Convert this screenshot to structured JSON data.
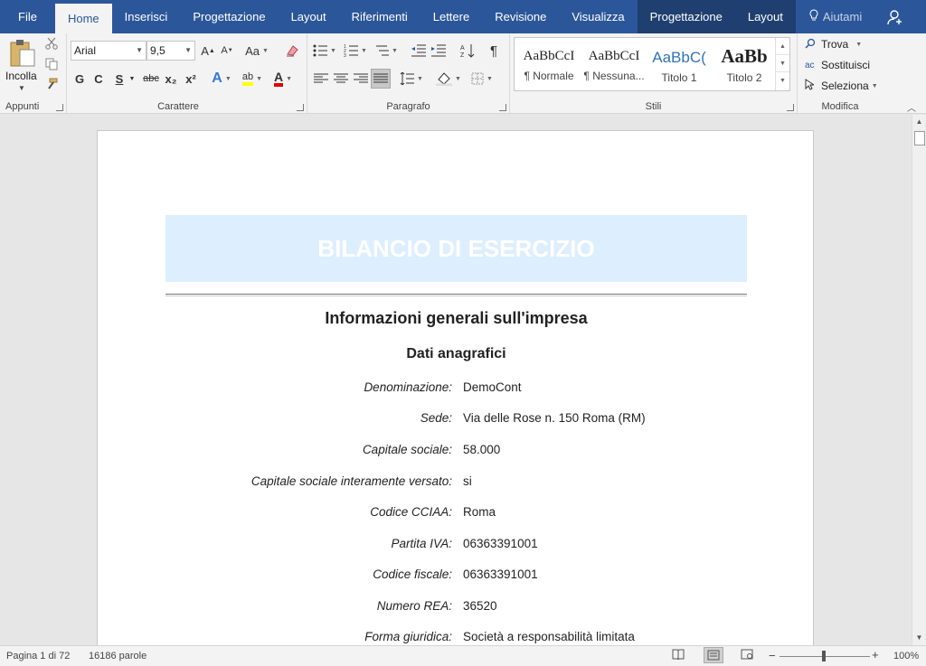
{
  "tabs": [
    {
      "label": "File"
    },
    {
      "label": "Home"
    },
    {
      "label": "Inserisci"
    },
    {
      "label": "Progettazione"
    },
    {
      "label": "Layout"
    },
    {
      "label": "Riferimenti"
    },
    {
      "label": "Lettere"
    },
    {
      "label": "Revisione"
    },
    {
      "label": "Visualizza"
    },
    {
      "label": "Progettazione"
    },
    {
      "label": "Layout"
    }
  ],
  "tell_me": "Aiutami",
  "ribbon": {
    "paste_label": "Incolla",
    "groups": {
      "clipboard": "Appunti",
      "font": "Carattere",
      "paragraph": "Paragrafo",
      "styles": "Stili",
      "editing": "Modifica"
    },
    "font_name": "Arial",
    "font_size": "9,5",
    "bold": "G",
    "italic": "C",
    "underline": "S",
    "strike": "abc",
    "subscript": "x₂",
    "superscript": "x²",
    "case": "Aa",
    "styles": [
      {
        "sample": "AaBbCcI",
        "name": "¶ Normale"
      },
      {
        "sample": "AaBbCcI",
        "name": "¶ Nessuna..."
      },
      {
        "sample": "AaBbC(",
        "name": "Titolo 1"
      },
      {
        "sample": "AaBb",
        "name": "Titolo 2"
      }
    ],
    "editing": {
      "find": "Trova",
      "replace": "Sostituisci",
      "select": "Seleziona"
    }
  },
  "document": {
    "banner_title": "BILANCIO DI ESERCIZIO",
    "heading1": "Informazioni generali sull'impresa",
    "heading2": "Dati anagrafici",
    "fields": [
      {
        "label": "Denominazione:",
        "value": "DemoCont"
      },
      {
        "label": "Sede:",
        "value": "Via delle Rose n. 150 Roma (RM)"
      },
      {
        "label": "Capitale sociale:",
        "value": "58.000"
      },
      {
        "label": "Capitale sociale interamente versato:",
        "value": "si"
      },
      {
        "label": "Codice CCIAA:",
        "value": "Roma"
      },
      {
        "label": "Partita IVA:",
        "value": "06363391001"
      },
      {
        "label": "Codice fiscale:",
        "value": "06363391001"
      },
      {
        "label": "Numero REA:",
        "value": "36520"
      },
      {
        "label": "Forma giuridica:",
        "value": "Società a responsabilità limitata"
      }
    ]
  },
  "status": {
    "page": "Pagina 1 di 72",
    "words": "16186 parole",
    "zoom": "100%",
    "zoom_percent": 100
  },
  "colors": {
    "accent": "#2b579a",
    "banner_bg": "#ddeeff"
  }
}
